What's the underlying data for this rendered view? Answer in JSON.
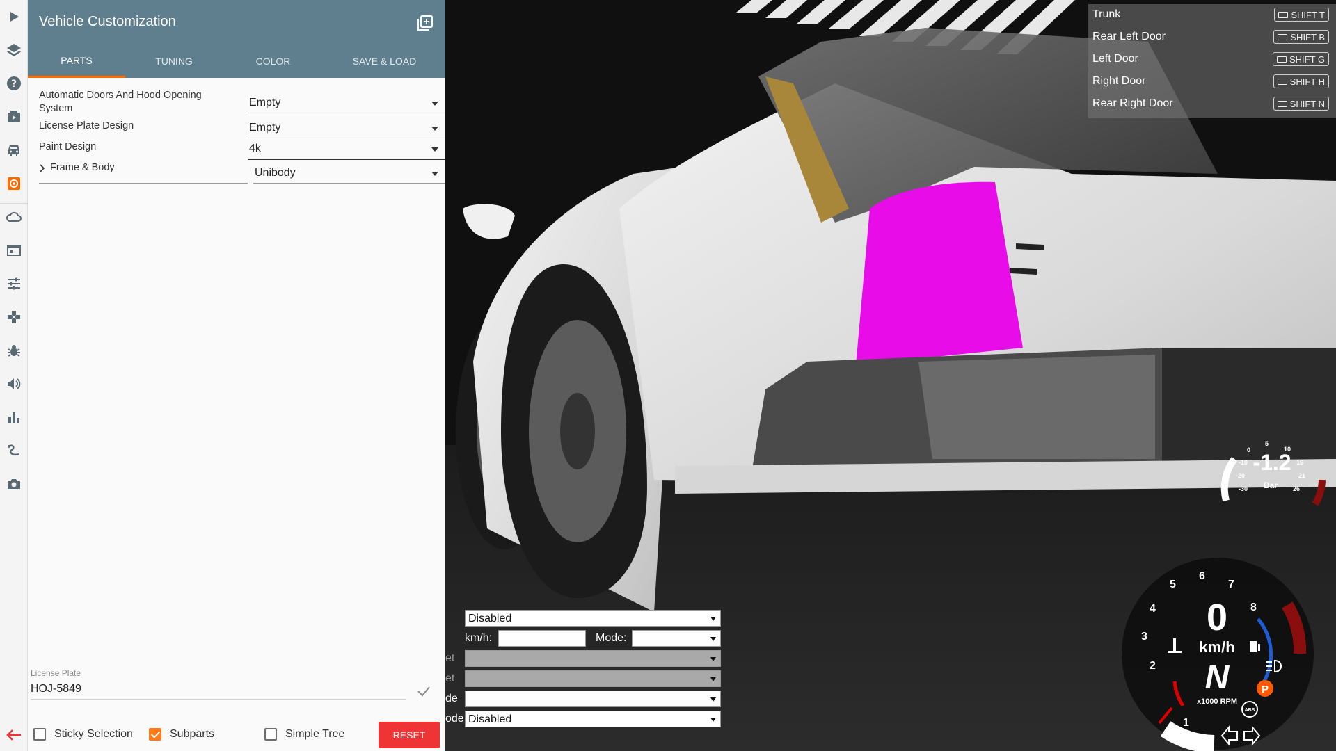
{
  "sidebar": {
    "icons": [
      "play-icon",
      "layers-icon",
      "help-icon",
      "video-icon",
      "car-icon",
      "vehicle-config-icon",
      "cloud-icon",
      "browser-icon",
      "sliders-icon",
      "gamepad-icon",
      "bug-icon",
      "volume-icon",
      "stats-icon",
      "route-icon",
      "camera-icon"
    ],
    "active_color": "#ff6a00"
  },
  "panel": {
    "title": "Vehicle Customization",
    "tabs": [
      {
        "label": "PARTS",
        "active": true
      },
      {
        "label": "TUNING",
        "active": false
      },
      {
        "label": "COLOR",
        "active": false
      },
      {
        "label": "SAVE & LOAD",
        "active": false
      }
    ],
    "parts": [
      {
        "label": "Automatic Doors And Hood Opening System",
        "value": "Empty"
      },
      {
        "label": "License Plate Design",
        "value": "Empty"
      },
      {
        "label": "Paint Design",
        "value": "4k"
      },
      {
        "label": "Frame & Body",
        "value": "Unibody"
      }
    ],
    "license_plate_label": "License Plate",
    "license_plate_value": "HOJ-5849",
    "footer": {
      "sticky_selection": "Sticky Selection",
      "subparts": "Subparts",
      "simple_tree": "Simple Tree",
      "reset": "RESET",
      "sticky_checked": false,
      "subparts_checked": true,
      "simple_checked": false
    },
    "header_color": "#5f7f8e",
    "accent_color": "#ff6a00",
    "reset_color": "#ee3434"
  },
  "doors": [
    {
      "name": "Trunk",
      "key": "SHIFT T"
    },
    {
      "name": "Rear Left Door",
      "key": "SHIFT B"
    },
    {
      "name": "Left Door",
      "key": "SHIFT G"
    },
    {
      "name": "Right Door",
      "key": "SHIFT H"
    },
    {
      "name": "Rear Right Door",
      "key": "SHIFT N"
    }
  ],
  "debug_form": {
    "row1_value": "Disabled",
    "kmh_label": "km/h:",
    "mode_label": "Mode:",
    "row3_label": "et",
    "row4_label": "et",
    "row5_label": "de",
    "row6_label": "ode",
    "row6_value": "Disabled"
  },
  "boost_gauge": {
    "value": "-1.2",
    "unit": "Bar",
    "ticks": [
      "0",
      "5",
      "10",
      "16",
      "21",
      "26",
      "-10",
      "-20",
      "-30"
    ]
  },
  "speed_gauge": {
    "speed": "0",
    "unit": "km/h",
    "gear": "N",
    "rpm_label": "x1000 RPM",
    "rpm_ticks": [
      "1",
      "2",
      "3",
      "4",
      "5",
      "6",
      "7",
      "8"
    ],
    "parking_label": "P",
    "abs_label": "ABS"
  }
}
